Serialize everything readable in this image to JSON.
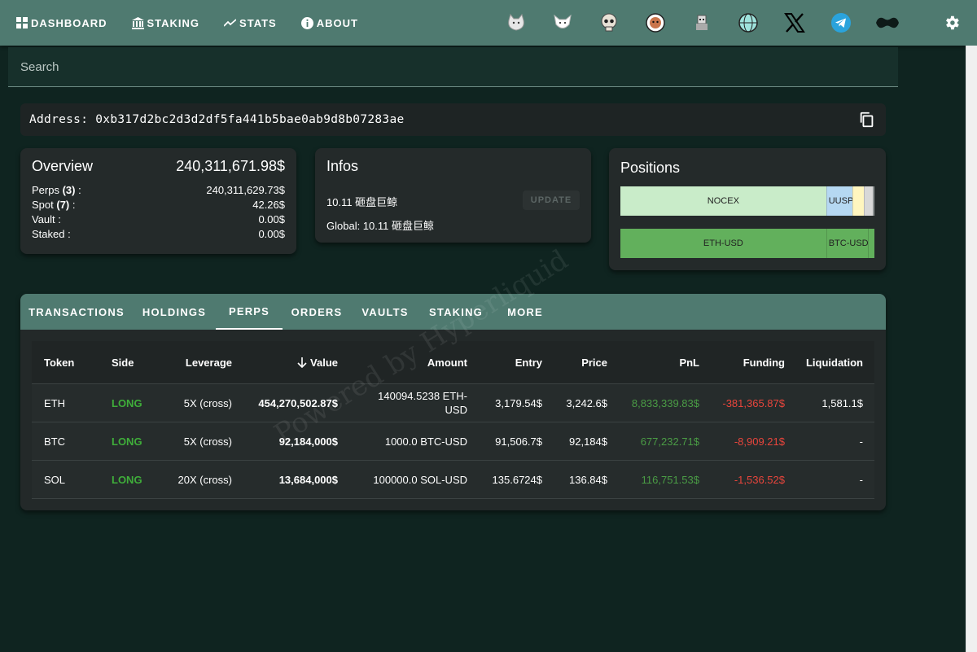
{
  "nav": {
    "items": [
      {
        "label": "DASHBOARD",
        "icon": "grid-icon"
      },
      {
        "label": "STAKING",
        "icon": "bank-icon"
      },
      {
        "label": "STATS",
        "icon": "trend-icon"
      },
      {
        "label": "ABOUT",
        "icon": "info-icon"
      }
    ],
    "icons": [
      "cat-icon",
      "fox-icon",
      "skull-icon",
      "face-icon",
      "character-icon",
      "globe-icon",
      "x-icon",
      "telegram-icon",
      "bow-icon"
    ],
    "settings_icon": "gear-icon"
  },
  "search": {
    "placeholder": "Search"
  },
  "address": {
    "text": "Address: 0xb317d2bc2d3d2df5fa441b5bae0ab9d8b07283ae"
  },
  "overview": {
    "title": "Overview",
    "total": "240,311,671.98$",
    "rows": [
      {
        "label": "Perps",
        "count": "(3)",
        "suffix": " :",
        "value": "240,311,629.73$"
      },
      {
        "label": "Spot",
        "count": "(7)",
        "suffix": " :",
        "value": "42.26$"
      },
      {
        "label": "Vault :",
        "count": "",
        "suffix": "",
        "value": "0.00$"
      },
      {
        "label": "Staked :",
        "count": "",
        "suffix": "",
        "value": "0.00$"
      }
    ]
  },
  "infos": {
    "title": "Infos",
    "line1": "10.11 砸盘巨鲸",
    "line2": "Global: 10.11 砸盘巨鲸",
    "update_label": "UPDATE"
  },
  "positions": {
    "title": "Positions",
    "bar1": [
      {
        "label": "NOCEX",
        "share": 0.81,
        "color": "#c9ecc9"
      },
      {
        "label": "UUSP",
        "share": 0.103,
        "color": "#b5d8f2"
      },
      {
        "label": "",
        "share": 0.045,
        "color": "#fff6bf"
      },
      {
        "label": "",
        "share": 0.036,
        "color": "#d8d8d8"
      },
      {
        "label": "",
        "share": 0.006,
        "color": "#9aa0a0"
      }
    ],
    "bar2": [
      {
        "label": "ETH-USD",
        "share": 0.81,
        "color": "#62b05c"
      },
      {
        "label": "BTC-USD",
        "share": 0.165,
        "color": "#62b05c"
      },
      {
        "label": "",
        "share": 0.025,
        "color": "#62b05c"
      }
    ]
  },
  "tabs": {
    "items": [
      "TRANSACTIONS",
      "HOLDINGS",
      "PERPS",
      "ORDERS",
      "VAULTS",
      "STAKING",
      "MORE"
    ],
    "active": "PERPS"
  },
  "table": {
    "headers": [
      "Token",
      "Side",
      "Leverage",
      "Value",
      "Amount",
      "Entry",
      "Price",
      "PnL",
      "Funding",
      "Liquidation"
    ],
    "rows": [
      {
        "token": "ETH",
        "side": "LONG",
        "leverage": "5X (cross)",
        "value": "454,270,502.87$",
        "amount": "140094.5238 ETH-USD",
        "entry": "3,179.54$",
        "price": "3,242.6$",
        "pnl": "8,833,339.83$",
        "funding": "-381,365.87$",
        "liquidation": "1,581.1$"
      },
      {
        "token": "BTC",
        "side": "LONG",
        "leverage": "5X (cross)",
        "value": "92,184,000$",
        "amount": "1000.0 BTC-USD",
        "entry": "91,506.7$",
        "price": "92,184$",
        "pnl": "677,232.71$",
        "funding": "-8,909.21$",
        "liquidation": "-"
      },
      {
        "token": "SOL",
        "side": "LONG",
        "leverage": "20X (cross)",
        "value": "13,684,000$",
        "amount": "100000.0 SOL-USD",
        "entry": "135.6724$",
        "price": "136.84$",
        "pnl": "116,751.53$",
        "funding": "-1,536.52$",
        "liquidation": "-"
      }
    ]
  },
  "watermark": "Powered by Hyperliquid",
  "colors": {
    "nav": "#4f7a70",
    "background": "#0f2420",
    "long": "#3fae3a",
    "negative": "#e8453c"
  }
}
